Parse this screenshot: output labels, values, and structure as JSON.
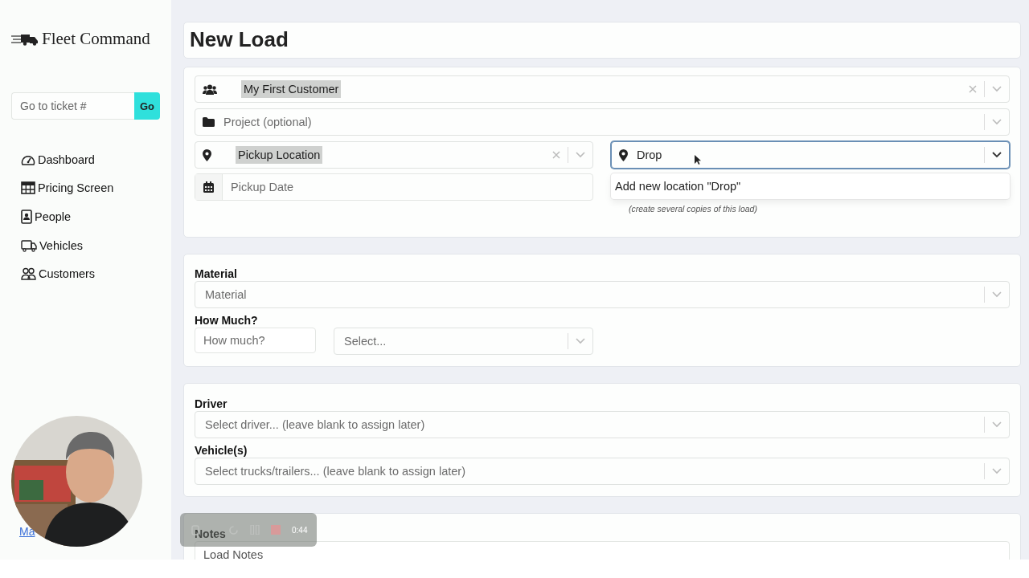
{
  "brand": {
    "name": "Fleet Command"
  },
  "ticket_search": {
    "placeholder": "Go to ticket #",
    "button": "Go"
  },
  "nav": [
    {
      "label": "Dashboard"
    },
    {
      "label": "Pricing Screen"
    },
    {
      "label": "People"
    },
    {
      "label": "Vehicles"
    },
    {
      "label": "Customers"
    }
  ],
  "footer_link": {
    "label": "Ma"
  },
  "page": {
    "title": "New Load"
  },
  "customer": {
    "value": "My First Customer",
    "highlighted": true
  },
  "project": {
    "placeholder": "Project (optional)"
  },
  "pickup_location": {
    "value": "Pickup Location",
    "highlighted": true
  },
  "drop_location": {
    "value": "Drop",
    "focused": true,
    "menu_option": "Add new location \"Drop\""
  },
  "pickup_date": {
    "placeholder": "Pickup Date"
  },
  "copies_hint": "(create several copies of this load)",
  "material": {
    "label": "Material",
    "placeholder": "Material"
  },
  "quantity": {
    "label": "How Much?",
    "placeholder": "How much?",
    "unit_placeholder": "Select..."
  },
  "driver": {
    "label": "Driver",
    "placeholder": "Select driver... (leave blank to assign later)"
  },
  "vehicles": {
    "label": "Vehicle(s)",
    "placeholder": "Select trucks/trailers... (leave blank to assign later)"
  },
  "notes": {
    "label": "Notes",
    "placeholder": "Load Notes"
  },
  "recorder": {
    "time": "0:44"
  }
}
